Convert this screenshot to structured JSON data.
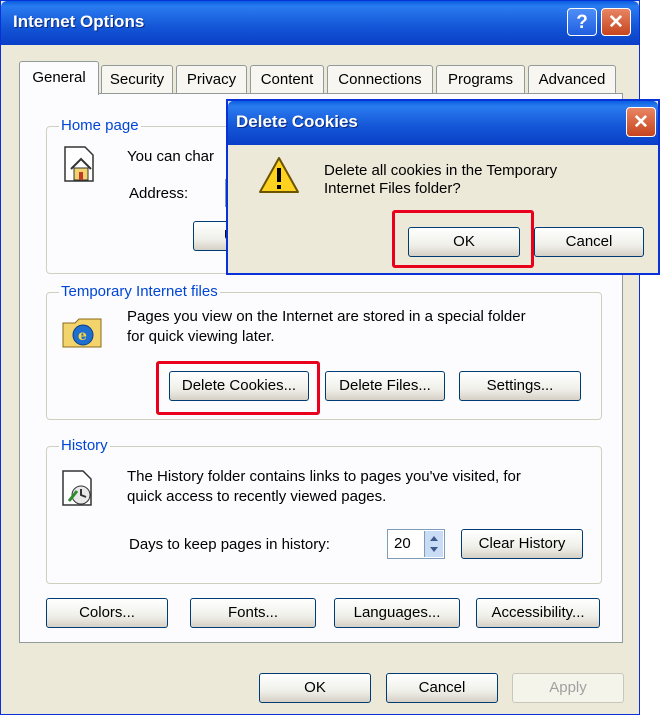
{
  "window": {
    "title": "Internet Options"
  },
  "tabs": [
    "General",
    "Security",
    "Privacy",
    "Content",
    "Connections",
    "Programs",
    "Advanced"
  ],
  "home_page": {
    "label": "Home page",
    "desc_partial": "You can char",
    "address_label": "Address:",
    "use_button_partial": "Us"
  },
  "temp_files": {
    "label": "Temporary Internet files",
    "desc_line1": "Pages you view on the Internet are stored in a special folder",
    "desc_line2": "for quick viewing later.",
    "delete_cookies": "Delete Cookies...",
    "delete_files": "Delete Files...",
    "settings": "Settings..."
  },
  "history": {
    "label": "History",
    "desc_line1": "The History folder contains links to pages you've visited, for",
    "desc_line2": "quick access to recently viewed pages.",
    "days_label": "Days to keep pages in history:",
    "days_value": "20",
    "clear_history": "Clear History"
  },
  "bottom_buttons": {
    "colors": "Colors...",
    "fonts": "Fonts...",
    "languages": "Languages...",
    "accessibility": "Accessibility..."
  },
  "footer": {
    "ok": "OK",
    "cancel": "Cancel",
    "apply": "Apply"
  },
  "dialog": {
    "title": "Delete Cookies",
    "message_line1": "Delete all cookies in the Temporary",
    "message_line2": "Internet Files folder?",
    "ok": "OK",
    "cancel": "Cancel"
  },
  "colors": {
    "highlight": "#e8001c",
    "titlebar": "#1355d6",
    "group_label": "#0046d5"
  }
}
